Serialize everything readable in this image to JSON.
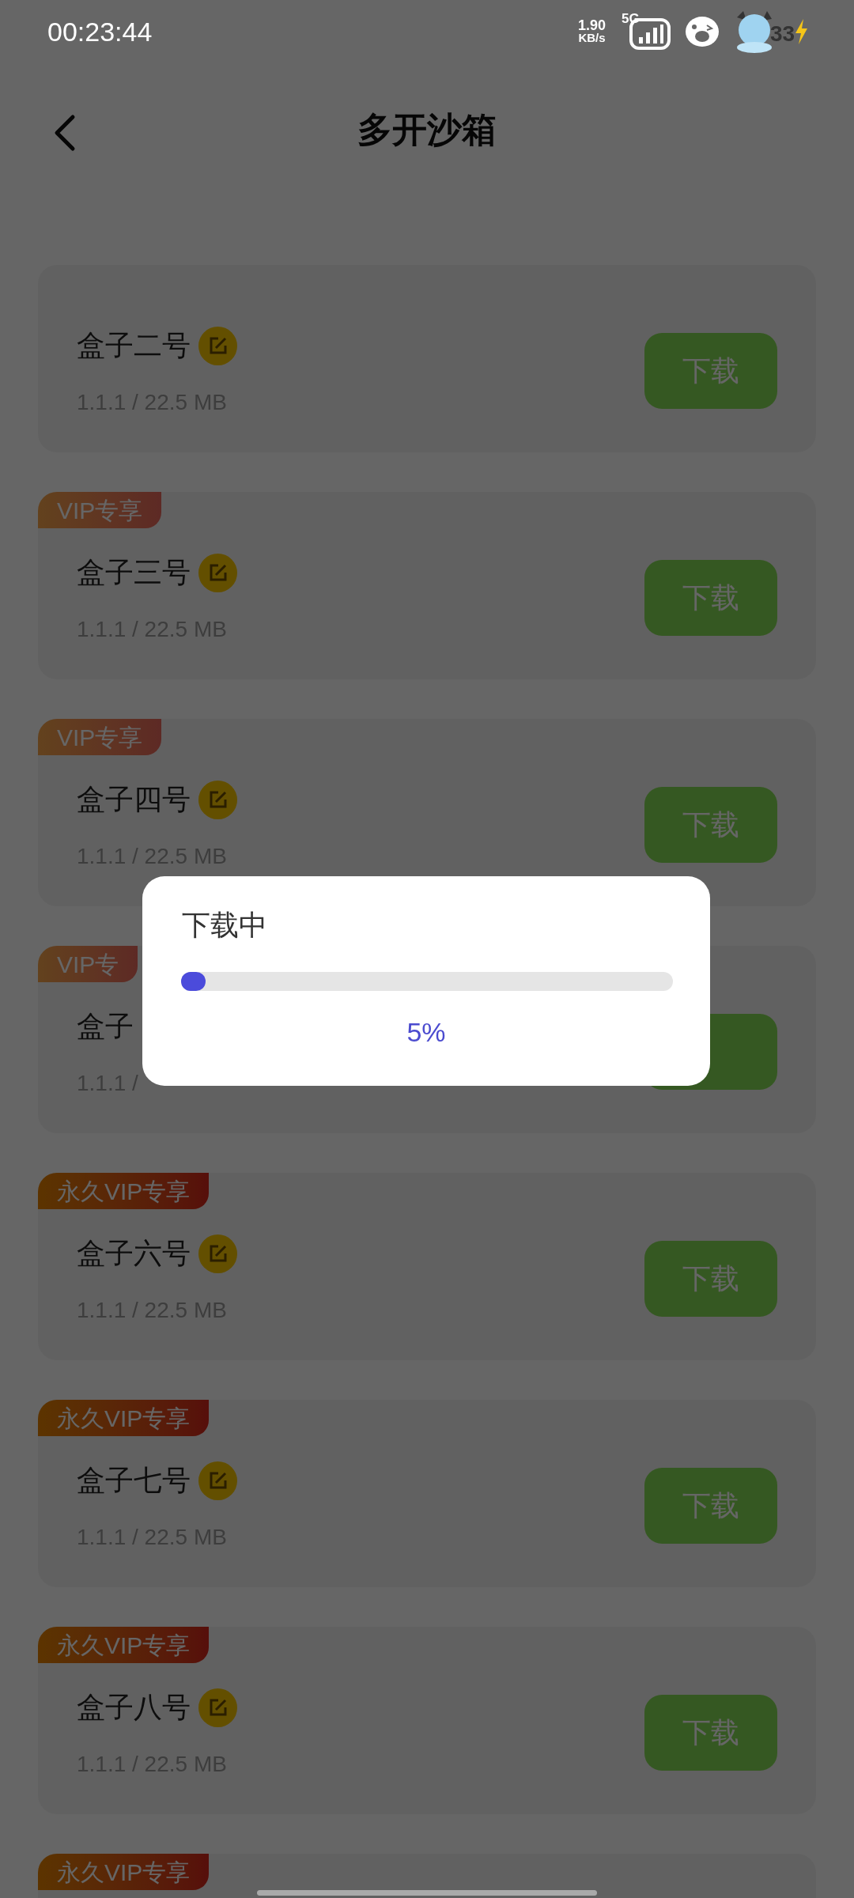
{
  "status_bar": {
    "time": "00:23:44",
    "net_speed": "1.90",
    "net_unit": "KB/s",
    "network": "5G",
    "battery": "33"
  },
  "header": {
    "title": "多开沙箱"
  },
  "items": [
    {
      "kind": "full",
      "name": "盒子二号",
      "info": "1.1.1 / 22.5 MB",
      "button": "下载"
    },
    {
      "kind": "full",
      "badge": {
        "label": "VIP专享",
        "kind": "vip"
      },
      "name": "盒子三号",
      "info": "1.1.1 / 22.5 MB",
      "button": "下载"
    },
    {
      "kind": "full",
      "badge": {
        "label": "VIP专享",
        "kind": "vip"
      },
      "name": "盒子四号",
      "info": "1.1.1 / 22.5 MB",
      "button": "下载"
    },
    {
      "kind": "partial",
      "badge": {
        "label": "VIP专",
        "kind": "vip"
      },
      "name": "盒子",
      "info": "1.1.1 /"
    },
    {
      "kind": "full",
      "badge": {
        "label": "永久VIP专享",
        "kind": "forever"
      },
      "name": "盒子六号",
      "info": "1.1.1 / 22.5 MB",
      "button": "下载"
    },
    {
      "kind": "full",
      "badge": {
        "label": "永久VIP专享",
        "kind": "forever"
      },
      "name": "盒子七号",
      "info": "1.1.1 / 22.5 MB",
      "button": "下载"
    },
    {
      "kind": "full",
      "badge": {
        "label": "永久VIP专享",
        "kind": "forever"
      },
      "name": "盒子八号",
      "info": "1.1.1 / 22.5 MB",
      "button": "下载"
    },
    {
      "kind": "badge_only",
      "badge": {
        "label": "永久VIP专享",
        "kind": "forever"
      }
    }
  ],
  "dialog": {
    "title": "下载中",
    "level": 0.05,
    "percent": "5%"
  }
}
